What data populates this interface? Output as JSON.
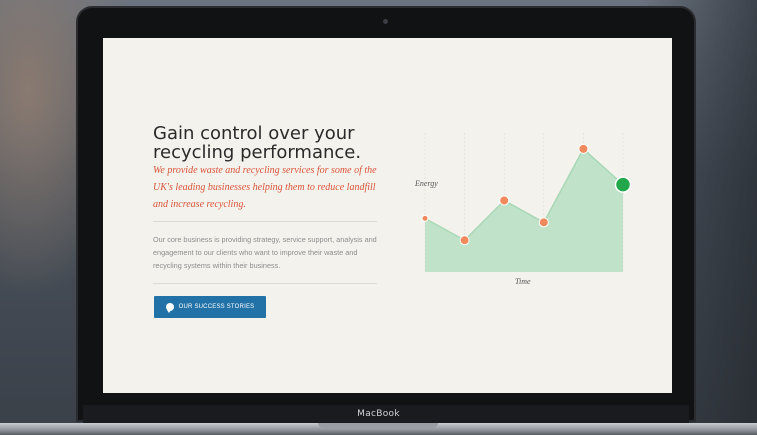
{
  "device": {
    "brand": "MacBook"
  },
  "hero": {
    "headline_line1": "Gain control over your",
    "headline_line2": "recycling performance.",
    "tagline": "We provide waste and recycling services for some of the UK's leading businesses helping them to reduce landfill and increase recycling.",
    "body": "Our core business is providing strategy, service support, analysis and engagement to our clients who want to improve their waste and recycling systems within their business.",
    "cta_label": "OUR SUCCESS STORIES",
    "cta_icon": "speech-bubble-icon"
  },
  "colors": {
    "accent": "#d9543a",
    "button": "#2272a8",
    "chart_fill": "#bfe2c8",
    "chart_line": "#a8d8b6",
    "point": "#f08a5d",
    "highlight_point": "#22a84a",
    "screen_bg": "#f4f2ec"
  },
  "chart_data": {
    "type": "area",
    "xlabel": "Time",
    "ylabel": "Energy",
    "x": [
      0,
      1,
      2,
      3,
      4,
      5
    ],
    "values": [
      2.7,
      1.6,
      3.6,
      2.5,
      6.2,
      4.4
    ],
    "ylim": [
      0,
      7
    ],
    "grid": true,
    "highlight_index": 5
  }
}
